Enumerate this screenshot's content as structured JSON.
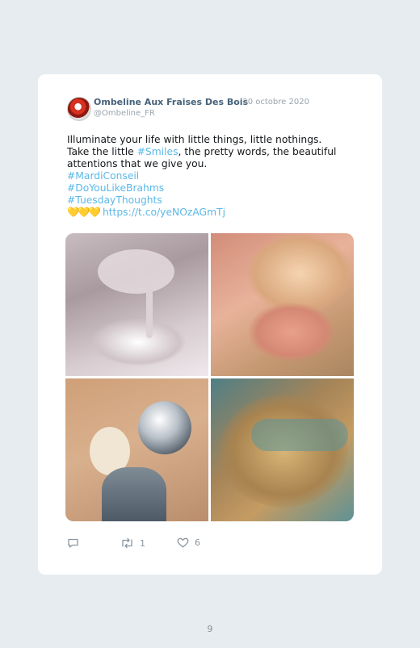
{
  "tweet": {
    "author_name": "Ombeline Aux Fraises Des Bois",
    "date": "· 20 octobre 2020",
    "handle": "@Ombeline_FR",
    "lines": {
      "l1": "Illuminate your life with little things, little nothings.",
      "l2_a": "Take the little ",
      "l2_link": "#Smiles",
      "l2_b": ", the pretty words, the beautiful",
      "l3": "attentions that we give you.",
      "tag1": "#MardiConseil",
      "tag2": "#DoYouLikeBrahms",
      "tag3": "#TuesdayThoughts",
      "hearts": "💛💛💛",
      "url": "https://t.co/yeNOzAGmTj"
    },
    "stats": {
      "replies": "",
      "retweets": "1",
      "likes": "6"
    }
  },
  "icons": {
    "reply": "reply-icon",
    "retweet": "retweet-icon",
    "like": "heart-icon"
  },
  "colors": {
    "link": "#5bb8e8",
    "name": "#46627a",
    "muted": "#9aa5ad",
    "hearts": "#f3c132"
  },
  "page_number": "9"
}
